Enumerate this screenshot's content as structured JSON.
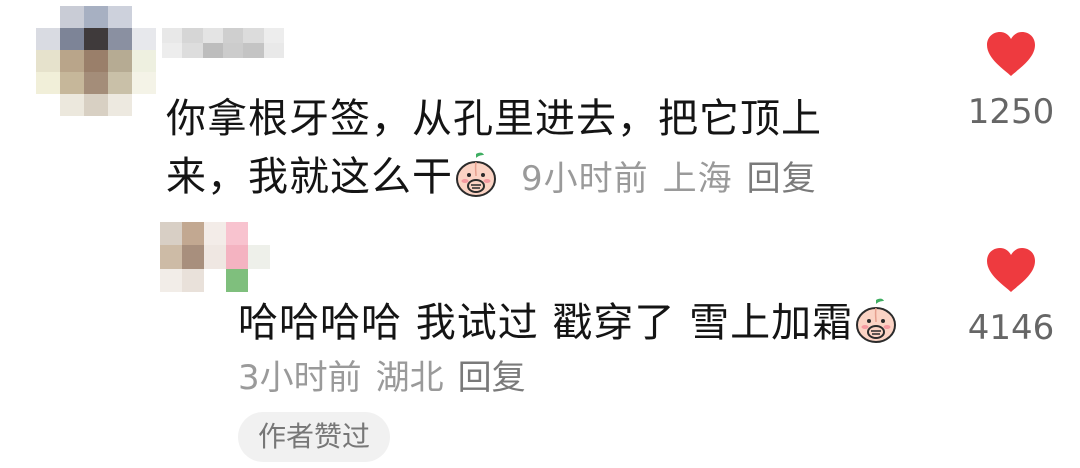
{
  "comment": {
    "text_line1": "你拿根牙签，从孔里进去，把它顶上",
    "text_line2": "来，我就这么干",
    "time": "9小时前",
    "location": "上海",
    "reply_label": "回复",
    "like_count": "1250",
    "emoji_icon": "peach-covering-mouth-emoji"
  },
  "reply": {
    "text": "哈哈哈哈 我试过 戳穿了 雪上加霜",
    "time": "3小时前",
    "location": "湖北",
    "reply_label": "回复",
    "like_count": "4146",
    "author_liked_label": "作者赞过",
    "emoji_icon": "peach-covering-mouth-emoji"
  },
  "colors": {
    "heart": "#ee3a3f",
    "text": "#141414",
    "meta": "#9a9a9a"
  }
}
